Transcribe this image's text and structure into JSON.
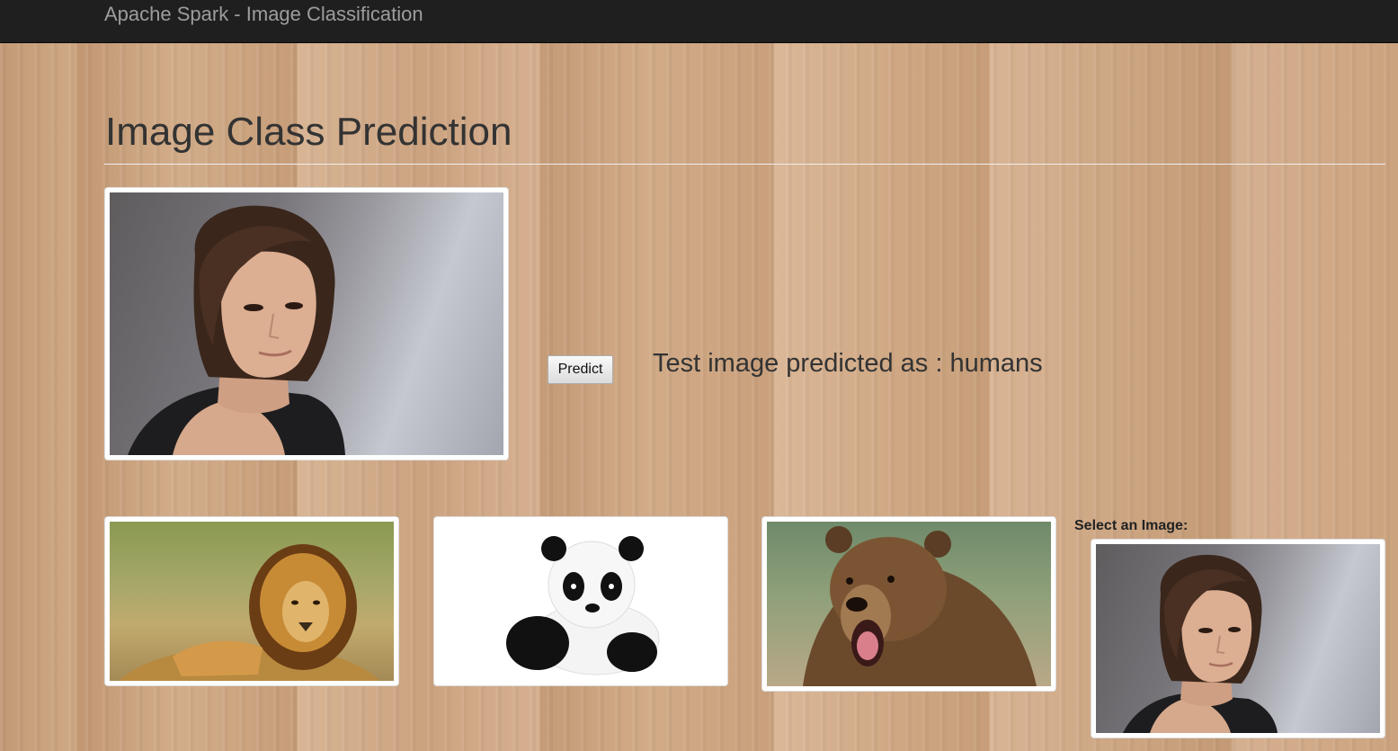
{
  "navbar": {
    "brand": "Apache Spark - Image Classification"
  },
  "page": {
    "title": "Image Class Prediction"
  },
  "test_image": {
    "subject": "humans"
  },
  "predict_button": {
    "label": "Predict"
  },
  "result": {
    "text": "Test image predicted as : humans"
  },
  "gallery": {
    "items": [
      {
        "name": "lion"
      },
      {
        "name": "panda"
      },
      {
        "name": "bear"
      }
    ]
  },
  "selector": {
    "label": "Select an Image:"
  }
}
